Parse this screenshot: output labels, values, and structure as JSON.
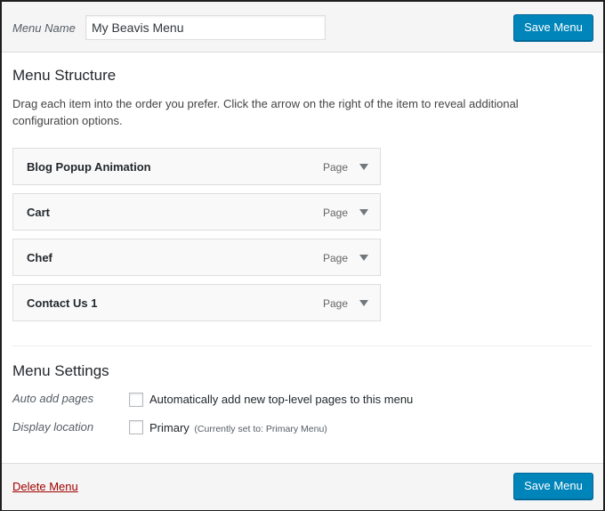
{
  "header": {
    "menu_name_label": "Menu Name",
    "menu_name_value": "My Beavis Menu",
    "save_label": "Save Menu"
  },
  "structure": {
    "title": "Menu Structure",
    "instructions": "Drag each item into the order you prefer. Click the arrow on the right of the item to reveal additional configuration options.",
    "items": [
      {
        "title": "Blog Popup Animation",
        "type": "Page"
      },
      {
        "title": "Cart",
        "type": "Page"
      },
      {
        "title": "Chef",
        "type": "Page"
      },
      {
        "title": "Contact Us 1",
        "type": "Page"
      }
    ]
  },
  "settings": {
    "title": "Menu Settings",
    "auto_add_label": "Auto add pages",
    "auto_add_text": "Automatically add new top-level pages to this menu",
    "auto_add_checked": false,
    "display_location_label": "Display location",
    "primary_text": "Primary",
    "primary_note": "(Currently set to: Primary Menu)",
    "primary_checked": false
  },
  "footer": {
    "delete_label": "Delete Menu",
    "save_label": "Save Menu"
  },
  "colors": {
    "primary_button": "#0085ba",
    "delete_link": "#a00000",
    "bar_background": "#f5f5f5"
  },
  "icons": {
    "item_toggle": "triangle-down-icon"
  }
}
